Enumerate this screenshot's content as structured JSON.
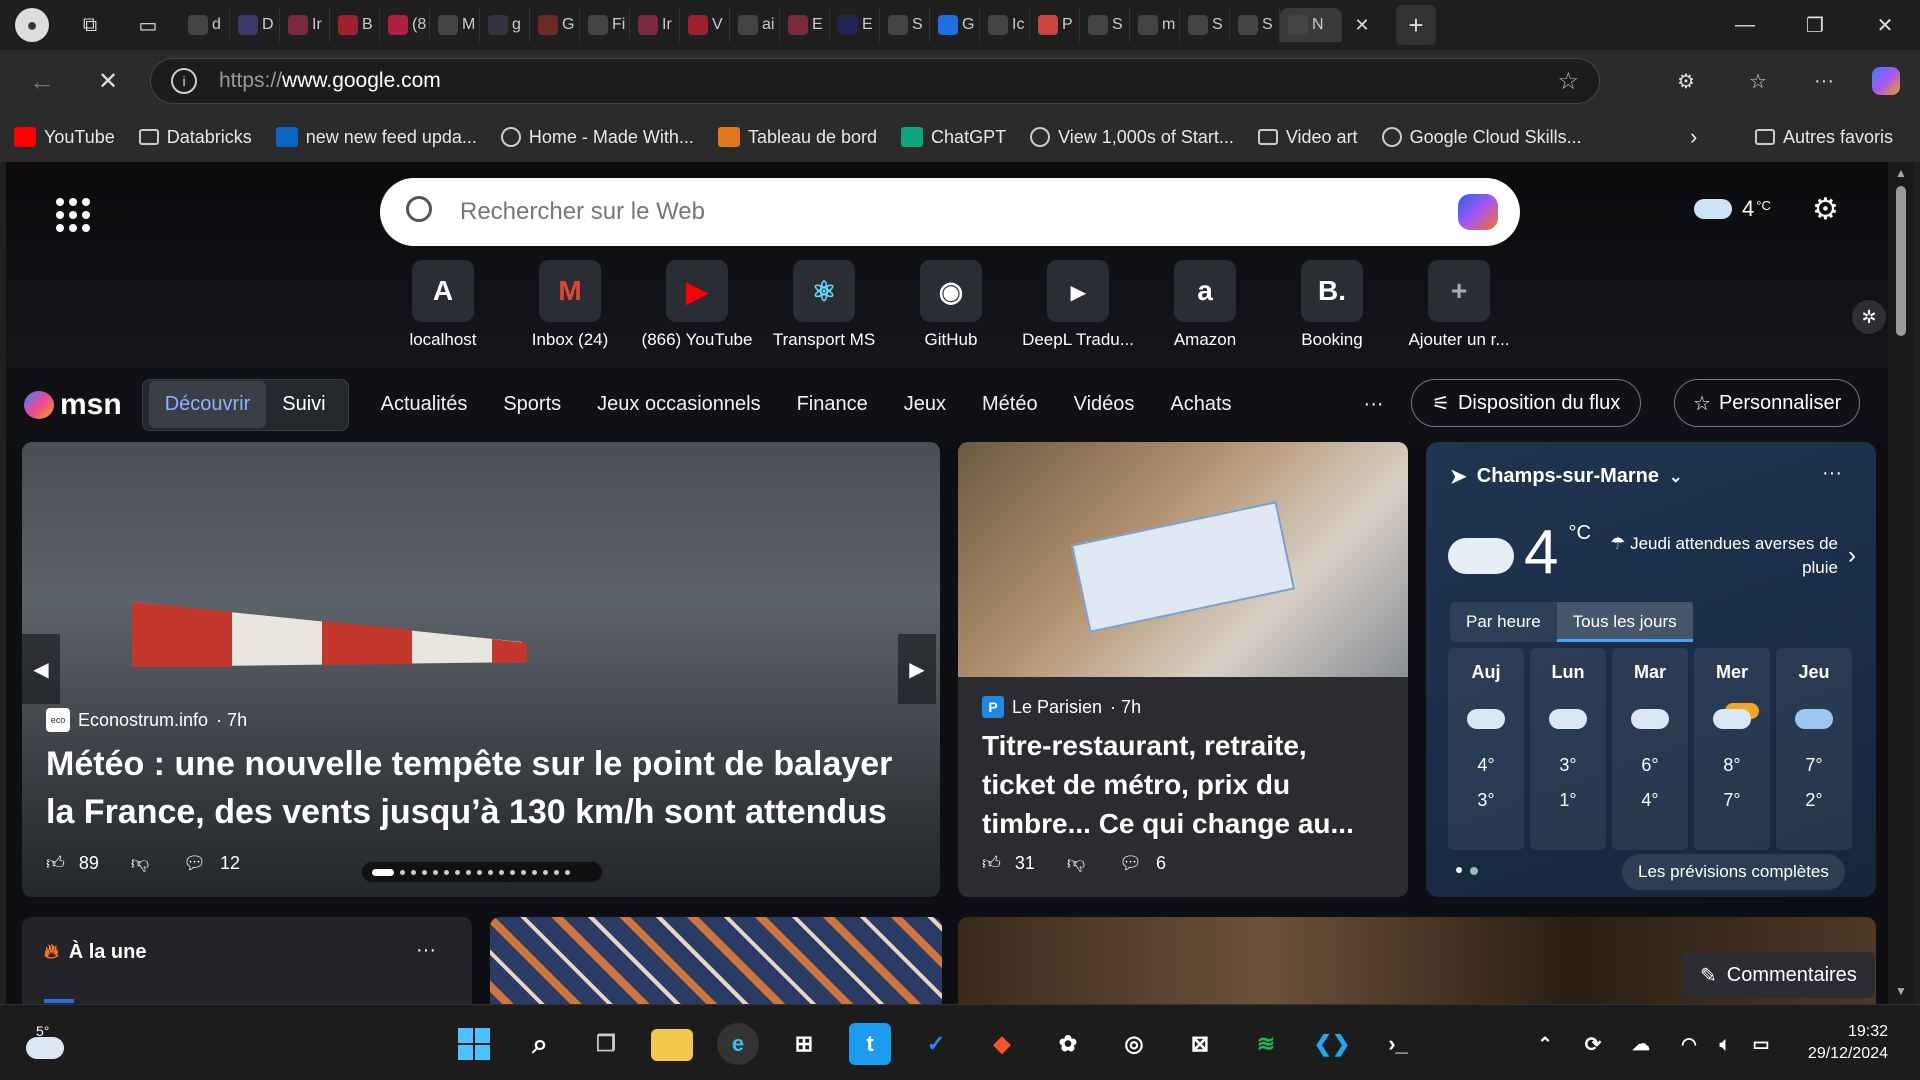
{
  "browser": {
    "url_scheme": "https://",
    "url_host": "www.google.com",
    "tabs": [
      "d",
      "D",
      "Ir",
      "B",
      "(8",
      "M",
      "g",
      "G",
      "Fi",
      "Ir",
      "V",
      "ai",
      "E",
      "E",
      "S",
      "G",
      "Ic",
      "P",
      "S",
      "m",
      "S",
      "S",
      "N"
    ],
    "bookmarks": [
      {
        "label": "YouTube",
        "icon": "youtube-icon",
        "color": "#ff0000"
      },
      {
        "label": "Databricks",
        "icon": "folder-icon",
        "color": "#cccccc"
      },
      {
        "label": "new new feed upda...",
        "icon": "linkedin-icon",
        "color": "#0a66c2"
      },
      {
        "label": "Home - Made With...",
        "icon": "globe-icon",
        "color": "#cccccc"
      },
      {
        "label": "Tableau de bord",
        "icon": "fox-icon",
        "color": "#e2761b"
      },
      {
        "label": "ChatGPT",
        "icon": "chatgpt-icon",
        "color": "#10a37f"
      },
      {
        "label": "View 1,000s of Start...",
        "icon": "globe-icon",
        "color": "#cccccc"
      },
      {
        "label": "Video art",
        "icon": "folder-icon",
        "color": "#cccccc"
      },
      {
        "label": "Google Cloud Skills...",
        "icon": "globe-icon",
        "color": "#cccccc"
      }
    ],
    "other_favorites": "Autres favoris"
  },
  "newtab": {
    "search_placeholder": "Rechercher sur le Web",
    "weather_temp": "4",
    "weather_unit": "°C",
    "quicklinks": [
      {
        "label": "localhost",
        "glyph": "A",
        "bg": "#2a2d33",
        "fg": "#ffffff"
      },
      {
        "label": "Inbox (24)",
        "glyph": "M",
        "bg": "#2a2d33",
        "fg": "#ea4335"
      },
      {
        "label": "(866) YouTube",
        "glyph": "▶",
        "bg": "#2a2d33",
        "fg": "#ff0000"
      },
      {
        "label": "Transport MS",
        "glyph": "⚛",
        "bg": "#2a2d33",
        "fg": "#61dafb"
      },
      {
        "label": "GitHub",
        "glyph": "◉",
        "bg": "#2a2d33",
        "fg": "#ffffff"
      },
      {
        "label": "DeepL Tradu...",
        "glyph": "▸",
        "bg": "#2a2d33",
        "fg": "#ffffff"
      },
      {
        "label": "Amazon",
        "glyph": "a",
        "bg": "#2a2d33",
        "fg": "#ffffff"
      },
      {
        "label": "Booking",
        "glyph": "B.",
        "bg": "#2a2d33",
        "fg": "#ffffff"
      },
      {
        "label": "Ajouter un r...",
        "glyph": "+",
        "bg": "#2a2d33",
        "fg": "#aaaaaa"
      }
    ]
  },
  "msn": {
    "logo": "msn",
    "tabs": [
      "Découvrir",
      "Suivi"
    ],
    "nav": [
      "Actualités",
      "Sports",
      "Jeux occasionnels",
      "Finance",
      "Jeux",
      "Météo",
      "Vidéos",
      "Achats"
    ],
    "more": "···",
    "layout_btn": "Disposition du flux",
    "personalize_btn": "Personnaliser"
  },
  "hero_article": {
    "source": "Econostrum.info",
    "age": "· 7h",
    "title": "Météo : une nouvelle tempête sur le point de balayer la France, des vents jusqu’à 130 km/h sont attendus",
    "likes": "89",
    "comments": "12"
  },
  "side_article": {
    "source": "Le Parisien",
    "age": "· 7h",
    "title": "Titre-restaurant, retraite, ticket de métro, prix du timbre... Ce qui change au...",
    "likes": "31",
    "comments": "6"
  },
  "weather": {
    "location": "Champs-sur-Marne",
    "temp": "4",
    "unit": "°C",
    "alert": "Jeudi attendues averses de pluie",
    "tab_hourly": "Par heure",
    "tab_daily": "Tous les jours",
    "days": [
      {
        "name": "Auj",
        "hi": "4°",
        "lo": "3°",
        "icon": "cloud-icon"
      },
      {
        "name": "Lun",
        "hi": "3°",
        "lo": "1°",
        "icon": "cloud-icon"
      },
      {
        "name": "Mar",
        "hi": "6°",
        "lo": "4°",
        "icon": "cloud-icon"
      },
      {
        "name": "Mer",
        "hi": "8°",
        "lo": "7°",
        "icon": "partly-sunny-icon"
      },
      {
        "name": "Jeu",
        "hi": "7°",
        "lo": "2°",
        "icon": "rain-icon"
      }
    ],
    "full_forecast": "Les prévisions complètes"
  },
  "headlines": {
    "title": "À la une",
    "more": "···"
  },
  "feedback": "Commentaires",
  "taskbar": {
    "temp": "5°",
    "time": "19:32",
    "date": "29/12/2024"
  }
}
